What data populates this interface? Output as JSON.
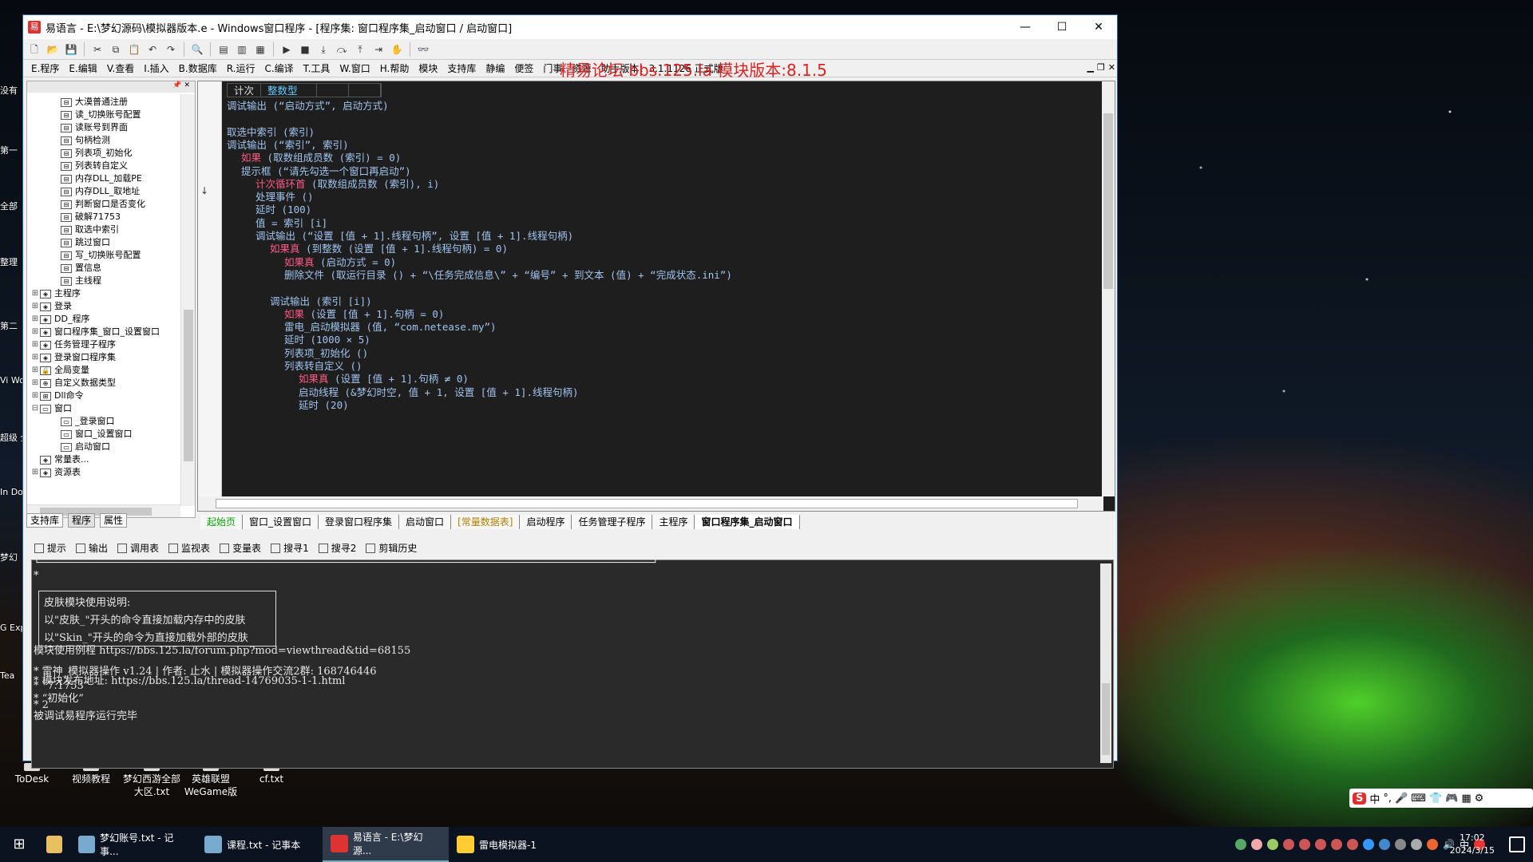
{
  "desktop": {
    "left_labels": [
      "没有",
      "第一",
      "全部",
      "整理",
      "第二",
      "Vi Wo",
      "超级 全能",
      "In Do",
      "梦幻",
      "G Exp",
      "Tea"
    ],
    "icons": [
      {
        "label": "ToDesk"
      },
      {
        "label": "视频教程"
      },
      {
        "label": "梦幻西游全部大区.txt"
      },
      {
        "label": "英雄联盟WeGame版"
      },
      {
        "label": "cf.txt"
      }
    ]
  },
  "window": {
    "title": "易语言 - E:\\梦幻源码\\模拟器版本.e - Windows窗口程序 - [程序集: 窗口程序集_启动窗口 / 启动窗口]",
    "controls": {
      "minimize": "—",
      "maximize": "☐",
      "close": "✕"
    }
  },
  "menu": {
    "items": [
      "E.程序",
      "E.编辑",
      "V.查看",
      "I.插入",
      "B.数据库",
      "R.运行",
      "C.编译",
      "T.工具",
      "W.窗口",
      "H.帮助",
      "模块",
      "支持库",
      "静编",
      "便签",
      "门事",
      "资源",
      "助手版本：3.1.1126 正式版"
    ],
    "watermark": "精易论坛 bbs.125.la 模块版本:8.1.5"
  },
  "tree": {
    "items": [
      {
        "label": "大漠普通注册",
        "level": 2,
        "icon": "sub"
      },
      {
        "label": "读_切换账号配置",
        "level": 2,
        "icon": "sub"
      },
      {
        "label": "读账号到界面",
        "level": 2,
        "icon": "sub"
      },
      {
        "label": "句柄检测",
        "level": 2,
        "icon": "sub"
      },
      {
        "label": "列表项_初始化",
        "level": 2,
        "icon": "sub"
      },
      {
        "label": "列表转自定义",
        "level": 2,
        "icon": "sub"
      },
      {
        "label": "内存DLL_加载PE",
        "level": 2,
        "icon": "sub"
      },
      {
        "label": "内存DLL_取地址",
        "level": 2,
        "icon": "sub"
      },
      {
        "label": "判断窗口是否变化",
        "level": 2,
        "icon": "sub"
      },
      {
        "label": "破解71753",
        "level": 2,
        "icon": "sub"
      },
      {
        "label": "取选中索引",
        "level": 2,
        "icon": "sub"
      },
      {
        "label": "跳过窗口",
        "level": 2,
        "icon": "sub"
      },
      {
        "label": "写_切换账号配置",
        "level": 2,
        "icon": "sub"
      },
      {
        "label": "置信息",
        "level": 2,
        "icon": "sub"
      },
      {
        "label": "主线程",
        "level": 2,
        "icon": "sub"
      },
      {
        "label": "主程序",
        "level": 1,
        "icon": "mod",
        "toggle": "+"
      },
      {
        "label": "登录",
        "level": 1,
        "icon": "mod",
        "toggle": "+"
      },
      {
        "label": "DD_程序",
        "level": 1,
        "icon": "mod",
        "toggle": "+"
      },
      {
        "label": "窗口程序集_窗口_设置窗口",
        "level": 1,
        "icon": "mod",
        "toggle": "+"
      },
      {
        "label": "任务管理子程序",
        "level": 1,
        "icon": "mod",
        "toggle": "+"
      },
      {
        "label": "登录窗口程序集",
        "level": 1,
        "icon": "mod",
        "toggle": "+"
      },
      {
        "label": "全局变量",
        "level": 1,
        "icon": "lock",
        "toggle": "+"
      },
      {
        "label": "自定义数据类型",
        "level": 1,
        "icon": "type",
        "toggle": "+"
      },
      {
        "label": "Dll命令",
        "level": 1,
        "icon": "dll",
        "toggle": "+"
      },
      {
        "label": "窗口",
        "level": 1,
        "icon": "win",
        "toggle": "-"
      },
      {
        "label": "_登录窗口",
        "level": 2,
        "icon": "win"
      },
      {
        "label": "窗口_设置窗口",
        "level": 2,
        "icon": "win"
      },
      {
        "label": "启动窗口",
        "level": 2,
        "icon": "win"
      },
      {
        "label": "常量表...",
        "level": 1,
        "icon": "const",
        "toggle": ""
      },
      {
        "label": "资源表",
        "level": 1,
        "icon": "res",
        "toggle": "+"
      }
    ]
  },
  "left_tabs": [
    "支持库",
    "程序",
    "属性"
  ],
  "code": {
    "header": [
      "计次",
      "整数型"
    ],
    "lines": [
      {
        "indent": 0,
        "text": "调试输出 (“启动方式”, 启动方式)"
      },
      {
        "indent": 0,
        "text": ""
      },
      {
        "indent": 0,
        "text": "取选中索引 (索引)"
      },
      {
        "indent": 0,
        "text": "调试输出 (“索引”, 索引)"
      },
      {
        "indent": 1,
        "kw": "如果",
        "text": " (取数组成员数 (索引) = 0)"
      },
      {
        "indent": 1,
        "text": "提示框 (“请先勾选一个窗口再启动”)"
      },
      {
        "indent": 2,
        "kw": "计次循环首",
        "text": " (取数组成员数 (索引), i)"
      },
      {
        "indent": 2,
        "text": "处理事件 ()"
      },
      {
        "indent": 2,
        "text": "延时 (100)"
      },
      {
        "indent": 2,
        "text": "值 = 索引 [i]"
      },
      {
        "indent": 2,
        "text": "调试输出 (“设置 [值 + 1].线程句柄”, 设置 [值 + 1].线程句柄)"
      },
      {
        "indent": 3,
        "kw": "如果真",
        "text": " (到整数 (设置 [值 + 1].线程句柄) = 0)"
      },
      {
        "indent": 4,
        "kw": "如果真",
        "text": " (启动方式 = 0)"
      },
      {
        "indent": 4,
        "text": "删除文件 (取运行目录 () + “\\任务完成信息\\” + “编号” + 到文本 (值) + “完成状态.ini”)"
      },
      {
        "indent": 4,
        "text": ""
      },
      {
        "indent": 3,
        "text": "调试输出 (索引 [i])"
      },
      {
        "indent": 4,
        "kw": "如果",
        "text": " (设置 [值 + 1].句柄 = 0)"
      },
      {
        "indent": 4,
        "text": "雷电_启动模拟器 (值, “com.netease.my”)"
      },
      {
        "indent": 4,
        "text": "延时 (1000 × 5)"
      },
      {
        "indent": 4,
        "text": "列表项_初始化 ()"
      },
      {
        "indent": 4,
        "text": "列表转自定义 ()"
      },
      {
        "indent": 5,
        "kw": "如果真",
        "text": " (设置 [值 + 1].句柄 ≠ 0)"
      },
      {
        "indent": 5,
        "text": "启动线程 (&梦幻时空, 值 + 1, 设置 [值 + 1].线程句柄)"
      },
      {
        "indent": 5,
        "text": "延时 (20)"
      }
    ]
  },
  "editor_tabs": [
    {
      "label": "起始页",
      "style": "g"
    },
    {
      "label": "窗口_设置窗口",
      "style": ""
    },
    {
      "label": "登录窗口程序集",
      "style": ""
    },
    {
      "label": "启动窗口",
      "style": ""
    },
    {
      "label": "[常量数据表]",
      "style": "y"
    },
    {
      "label": "启动程序",
      "style": ""
    },
    {
      "label": "任务管理子程序",
      "style": ""
    },
    {
      "label": "主程序",
      "style": ""
    },
    {
      "label": "窗口程序集_启动窗口",
      "style": "on"
    }
  ],
  "bottom_tabs": [
    "提示",
    "输出",
    "调用表",
    "监视表",
    "变量表",
    "搜寻1",
    "搜寻2",
    "剪辑历史"
  ],
  "output": {
    "box_lines": [
      "皮肤模块使用说明:",
      "以\"皮肤_\"开头的命令直接加载内存中的皮肤",
      "以\"Skin_\"开头的命令为直接加载外部的皮肤"
    ],
    "lines": [
      "*",
      "模块使用例程 https://bbs.125.la/forum.php?mod=viewthread&tid=68155",
      "* 雷神_模拟器操作 v1.24 | 作者: 止水 | 模拟器操作交流2群: 168746446",
      "* 模块发布地址: https://bbs.125.la/thread-14769035-1-1.html",
      "* “7.1753”",
      "* “初始化”",
      "* 2",
      "被调试易程序运行完毕"
    ]
  },
  "taskbar": {
    "apps": [
      {
        "label": "梦幻账号.txt - 记事..."
      },
      {
        "label": "课程.txt - 记事本"
      },
      {
        "label": "易语言 - E:\\梦幻源..."
      },
      {
        "label": "雷电模拟器-1"
      }
    ],
    "tray_lang": "中",
    "time": "17:02",
    "date": "2024/3/15"
  },
  "ime": {
    "logo": "S",
    "mode": "中"
  }
}
